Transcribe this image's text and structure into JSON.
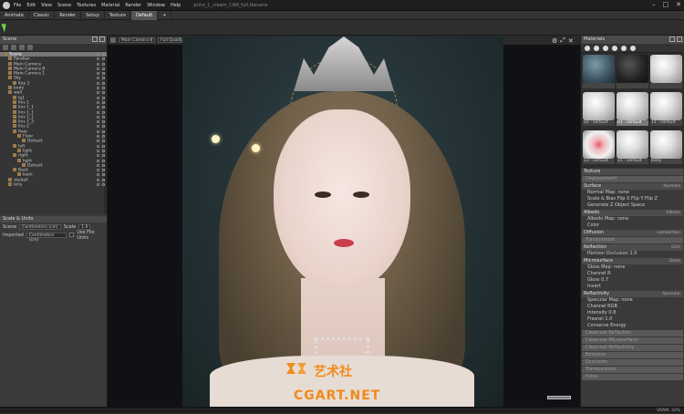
{
  "titlebar": {
    "menus": [
      "File",
      "Edit",
      "View",
      "Scene",
      "Textures",
      "Material",
      "Render",
      "Window",
      "Help"
    ],
    "document": "prinz_1_cream_CAN_full.tbscene"
  },
  "tabs": [
    {
      "label": "Animate"
    },
    {
      "label": "Classic"
    },
    {
      "label": "Render"
    },
    {
      "label": "Setup"
    },
    {
      "label": "Texture"
    },
    {
      "label": "Default"
    },
    {
      "label": "+"
    }
  ],
  "scene": {
    "title": "Scene",
    "tree": [
      {
        "label": "Scene",
        "depth": 0,
        "sel": true
      },
      {
        "label": "Parallax",
        "depth": 1
      },
      {
        "label": "Main Camera",
        "depth": 1
      },
      {
        "label": "Main Camera 8",
        "depth": 1
      },
      {
        "label": "Main Camera 1",
        "depth": 1
      },
      {
        "label": "Sky",
        "depth": 1
      },
      {
        "label": "Key 2",
        "depth": 2
      },
      {
        "label": "body",
        "depth": 1
      },
      {
        "label": "wall",
        "depth": 1
      },
      {
        "label": "lg1",
        "depth": 2
      },
      {
        "label": "lins 1",
        "depth": 2
      },
      {
        "label": "lins 1_1",
        "depth": 2
      },
      {
        "label": "lins 1_1",
        "depth": 2
      },
      {
        "label": "lins 1_1",
        "depth": 2
      },
      {
        "label": "lins 1_2",
        "depth": 2
      },
      {
        "label": "lins 2",
        "depth": 2
      },
      {
        "label": "floor",
        "depth": 2
      },
      {
        "label": "Floor",
        "depth": 3
      },
      {
        "label": "Default",
        "depth": 4
      },
      {
        "label": "left",
        "depth": 2
      },
      {
        "label": "light",
        "depth": 3
      },
      {
        "label": "right",
        "depth": 2
      },
      {
        "label": "light",
        "depth": 3
      },
      {
        "label": "Default",
        "depth": 4
      },
      {
        "label": "Back",
        "depth": 2
      },
      {
        "label": "back",
        "depth": 3
      },
      {
        "label": "skyball",
        "depth": 1
      },
      {
        "label": "lens",
        "depth": 1
      }
    ],
    "units_title": "Scale & Units",
    "scene_label": "Scene",
    "scene_value": "Centimeters (cm)",
    "scale_label": "Scale",
    "scale_value": "1.0",
    "imported_label": "Imported",
    "imported_value": "Centimeters (cm)",
    "use_units_label": "Use File Units"
  },
  "viewport": {
    "camera": "Main Camera 8",
    "quality": "Full Quality"
  },
  "watermark": {
    "cn": "艺术社",
    "en": "CGART.NET"
  },
  "materials": {
    "title": "Materials",
    "cells": [
      {
        "label": "",
        "style": "blue"
      },
      {
        "label": "",
        "style": "dark"
      },
      {
        "label": "",
        "style": "plain"
      },
      {
        "label": "02 - Default",
        "style": "plain"
      },
      {
        "label": "01 - Default",
        "style": "plain",
        "sel": true
      },
      {
        "label": "11 - Default",
        "style": "plain"
      },
      {
        "label": "13 - Default",
        "style": "face"
      },
      {
        "label": "15 - Default",
        "style": "plain"
      },
      {
        "label": "body",
        "style": "plain"
      }
    ],
    "sections": [
      {
        "kind": "sec",
        "label": "Texture",
        "right": ""
      },
      {
        "kind": "ver",
        "label": "Displacement",
        "right": ""
      },
      {
        "kind": "sec",
        "label": "Surface",
        "right": "Normals"
      },
      {
        "kind": "prow",
        "label": "Normal Map: none"
      },
      {
        "kind": "prow",
        "label": "Scale & Bias    Flip X    Flip Y    Flip Z"
      },
      {
        "kind": "prow",
        "label": "Generate Z              Object Space"
      },
      {
        "kind": "sec",
        "label": "Albedo",
        "right": "Albedo"
      },
      {
        "kind": "prow",
        "label": "Albedo Map: none"
      },
      {
        "kind": "prow",
        "label": "Color"
      },
      {
        "kind": "sec",
        "label": "Diffusion",
        "right": "Lambertian"
      },
      {
        "kind": "ver",
        "label": "Transmission",
        "right": ""
      },
      {
        "kind": "sec",
        "label": "Reflection",
        "right": "GGX"
      },
      {
        "kind": "prow",
        "label": "Horizon Occlusion    1.0"
      },
      {
        "kind": "sec",
        "label": "Microsurface",
        "right": "Gloss"
      },
      {
        "kind": "prow",
        "label": "Gloss Map: none"
      },
      {
        "kind": "prow",
        "label": "Channel  R"
      },
      {
        "kind": "prow",
        "label": "Gloss    0.7"
      },
      {
        "kind": "prow",
        "label": "Invert"
      },
      {
        "kind": "sec",
        "label": "Reflectivity",
        "right": "Specular"
      },
      {
        "kind": "prow",
        "label": "Specular Map: none"
      },
      {
        "kind": "prow",
        "label": "Channel  RGB"
      },
      {
        "kind": "prow",
        "label": "Intensity    0.8"
      },
      {
        "kind": "prow",
        "label": "Fresnel    1.0"
      },
      {
        "kind": "prow",
        "label": "Conserve Energy"
      },
      {
        "kind": "ver",
        "label": "Clearcoat Reflection",
        "right": ""
      },
      {
        "kind": "ver",
        "label": "Clearcoat Microsurface",
        "right": ""
      },
      {
        "kind": "ver",
        "label": "Clearcoat Reflectivity",
        "right": ""
      },
      {
        "kind": "ver",
        "label": "Emissive",
        "right": ""
      },
      {
        "kind": "ver",
        "label": "Occlusion",
        "right": ""
      },
      {
        "kind": "ver",
        "label": "Transparency",
        "right": ""
      },
      {
        "kind": "ver",
        "label": "Extra",
        "right": ""
      }
    ]
  },
  "status": {
    "vram": "VRAM: 33%"
  }
}
